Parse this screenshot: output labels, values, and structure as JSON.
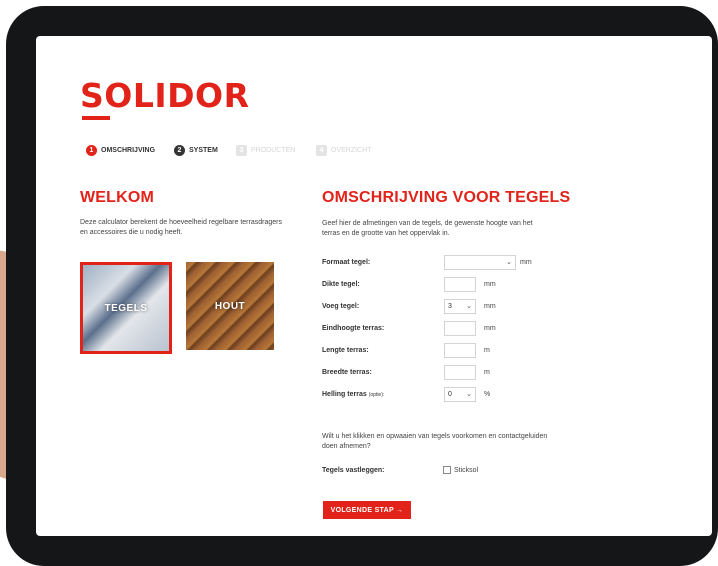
{
  "brand": {
    "logo": "SOLIDOR",
    "accent": "#e2231a"
  },
  "steps": [
    {
      "num": "1",
      "label": "OMSCHRIJVING",
      "state": "active"
    },
    {
      "num": "2",
      "label": "SYSTEM",
      "state": "done"
    },
    {
      "num": "3",
      "label": "PRODUCTEN",
      "state": "upcoming"
    },
    {
      "num": "4",
      "label": "OVERZICHT",
      "state": "upcoming"
    }
  ],
  "welcome": {
    "title": "WELKOM",
    "text": "Deze calculator berekent de hoeveelheid regelbare terrasdragers en accessoires die u nodig heeft.",
    "tiles": [
      {
        "label": "TEGELS",
        "selected": true
      },
      {
        "label": "HOUT",
        "selected": false
      }
    ]
  },
  "form": {
    "title": "OMSCHRIJVING VOOR TEGELS",
    "intro": "Geef hier de afmetingen van de tegels, de gewenste hoogte van het terras en de grootte van het oppervlak in.",
    "fields": [
      {
        "label": "Formaat tegel:",
        "type": "select",
        "value": "",
        "unit": "mm"
      },
      {
        "label": "Dikte tegel:",
        "type": "input",
        "value": "",
        "unit": "mm"
      },
      {
        "label": "Voeg tegel:",
        "type": "select",
        "value": "3",
        "unit": "mm"
      },
      {
        "label": "Eindhoogte terras:",
        "type": "input",
        "value": "",
        "unit": "mm"
      },
      {
        "label": "Lengte terras:",
        "type": "input",
        "value": "",
        "unit": "m"
      },
      {
        "label": "Breedte terras:",
        "type": "input",
        "value": "",
        "unit": "m"
      },
      {
        "label": "Helling terras",
        "sublabel": "(optie):",
        "type": "select",
        "value": "0",
        "unit": "%"
      }
    ],
    "question": "Wilt u het klikken en opwaaien van tegels voorkomen en contactgeluiden doen afnemen?",
    "fasten_label": "Tegels vastleggen:",
    "checkbox_label": "Sticksol",
    "next_button": "VOLGENDE STAP →"
  }
}
